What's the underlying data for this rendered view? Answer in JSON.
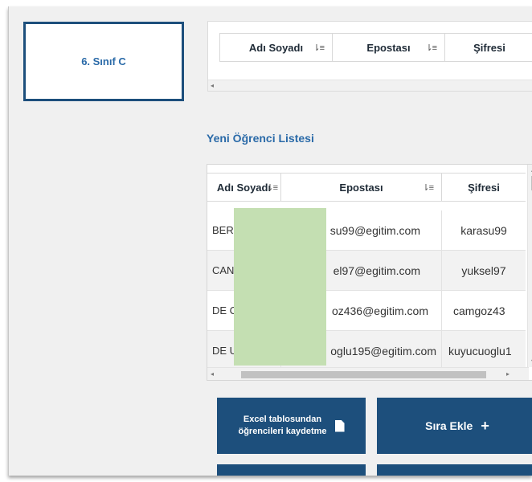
{
  "class_card": {
    "label": "6. Sınıf C"
  },
  "top_table": {
    "columns": [
      "Adı Soyadı",
      "Epostası",
      "Şifresi"
    ]
  },
  "section_title": "Yeni Öğrenci Listesi",
  "student_table": {
    "columns": [
      "Adı Soyadı",
      "Epostası",
      "Şifresi"
    ],
    "rows": [
      {
        "name": "BER KAR",
        "email": "su99@egitim.com",
        "password": "karasu99"
      },
      {
        "name": "CAN YÜK",
        "email": "el97@egitim.com",
        "password": "yuksel97"
      },
      {
        "name": "DE CAN",
        "email": "oz436@egitim.com",
        "password": "camgoz43"
      },
      {
        "name": "DE UYUC",
        "email": "oglu195@egitim.com",
        "password": "kuyucuoglu1"
      }
    ]
  },
  "buttons": {
    "excel_label_line1": "Excel tablosundan",
    "excel_label_line2": "öğrencileri kaydetme",
    "add_row_label": "Sıra Ekle"
  },
  "colors": {
    "accent": "#1d4f7c",
    "title": "#2a6aa8",
    "redaction": "#c4dfb2"
  }
}
